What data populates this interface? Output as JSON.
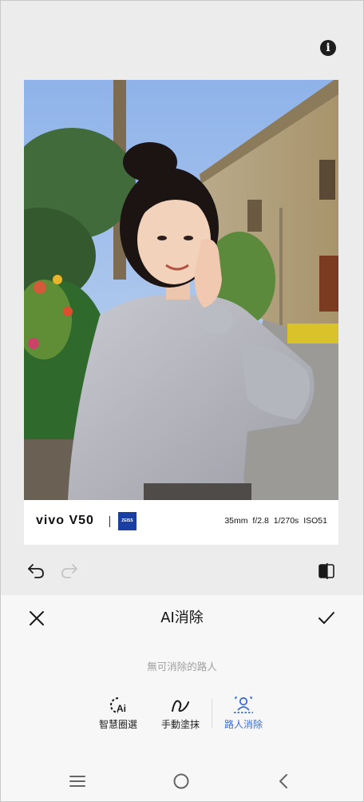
{
  "photo": {
    "brand_text": "vivo V50",
    "lens_logo_text": "ZEISS",
    "exif": "35mm f/2.8 1/270s ISO51"
  },
  "icons": {
    "info": "info-icon",
    "undo": "undo-icon",
    "redo": "redo-icon",
    "compare": "compare-icon",
    "close": "close-icon",
    "confirm": "check-icon",
    "nav_menu": "menu-icon",
    "nav_home": "home-icon",
    "nav_back": "back-icon"
  },
  "info_glyph": "i",
  "editor": {
    "title": "AI消除",
    "status_text": "無可消除的路人",
    "tools": [
      {
        "label": "智慧圈選",
        "icon": "ai-select-icon",
        "active": false
      },
      {
        "label": "手動塗抹",
        "icon": "brush-stroke-icon",
        "active": false
      },
      {
        "label": "路人消除",
        "icon": "passerby-remove-icon",
        "active": true
      }
    ]
  },
  "colors": {
    "accent": "#3b6ed8",
    "zeiss_blue": "#1a3fa3",
    "top_background": "#ececec",
    "panel_background": "#f7f7f7"
  }
}
